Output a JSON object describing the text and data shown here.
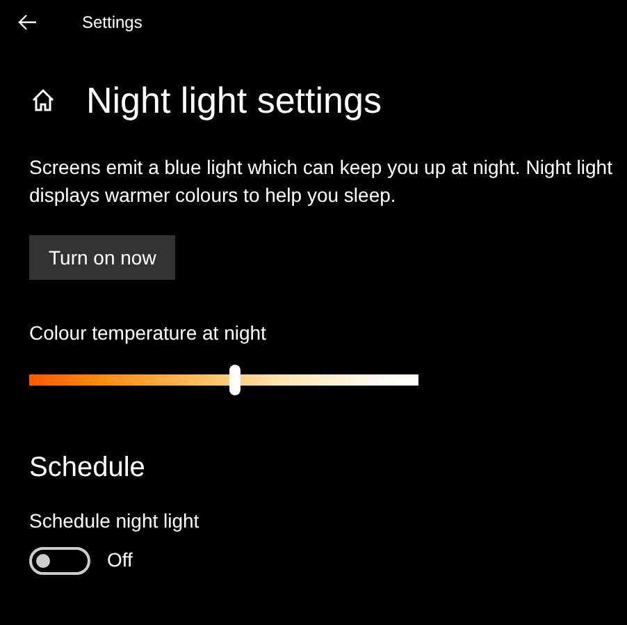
{
  "window": {
    "title": "Settings"
  },
  "page": {
    "title": "Night light settings",
    "description": "Screens emit a blue light which can keep you up at night. Night light displays warmer colours to help you sleep."
  },
  "turn_on_button": "Turn on now",
  "colour_temperature": {
    "label": "Colour temperature at night",
    "level": 0.53
  },
  "schedule": {
    "heading": "Schedule",
    "label": "Schedule night light",
    "on": false,
    "state_text": "Off"
  }
}
